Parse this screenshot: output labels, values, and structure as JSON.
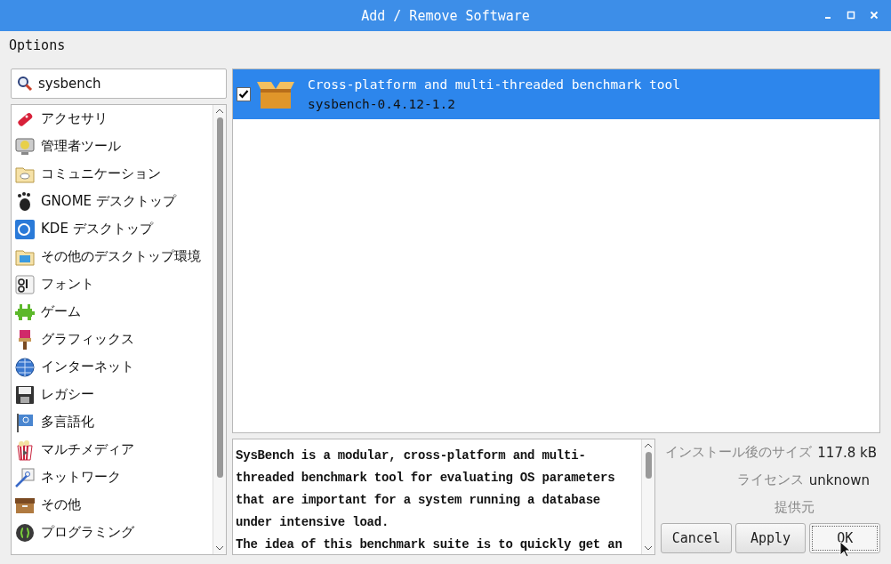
{
  "window": {
    "title": "Add / Remove Software"
  },
  "menu": [
    "Options"
  ],
  "search": {
    "value": "sysbench"
  },
  "categories": [
    {
      "label": "アクセサリ",
      "selected": false
    },
    {
      "label": "管理者ツール",
      "selected": false
    },
    {
      "label": "コミュニケーション",
      "selected": false
    },
    {
      "label": "GNOME デスクトップ",
      "selected": false
    },
    {
      "label": "KDE デスクトップ",
      "selected": false
    },
    {
      "label": "その他のデスクトップ環境",
      "selected": false
    },
    {
      "label": "フォント",
      "selected": false
    },
    {
      "label": "ゲーム",
      "selected": false
    },
    {
      "label": "グラフィックス",
      "selected": false
    },
    {
      "label": "インターネット",
      "selected": false
    },
    {
      "label": "レガシー",
      "selected": false
    },
    {
      "label": "多言語化",
      "selected": false
    },
    {
      "label": "マルチメディア",
      "selected": false
    },
    {
      "label": "ネットワーク",
      "selected": false
    },
    {
      "label": "その他",
      "selected": false
    },
    {
      "label": "プログラミング",
      "selected": false
    }
  ],
  "packages": [
    {
      "summary": "Cross-platform and multi-threaded benchmark tool",
      "name": "sysbench-0.4.12-1.2",
      "checked": true,
      "selected": true
    }
  ],
  "description": [
    "SysBench is a modular, cross-platform and multi-threaded benchmark tool for evaluating OS parameters that are important for a system running a database under intensive load.",
    "The idea of this benchmark suite is to quickly get an"
  ],
  "details": [
    {
      "label": "インストール後のサイズ",
      "value": "117.8 kB"
    },
    {
      "label": "ライセンス",
      "value": "unknown"
    },
    {
      "label": "提供元"
    }
  ],
  "buttons": [
    {
      "label": "Cancel",
      "focused": false
    },
    {
      "label": "Apply",
      "focused": false
    },
    {
      "label": "OK",
      "focused": true
    }
  ]
}
